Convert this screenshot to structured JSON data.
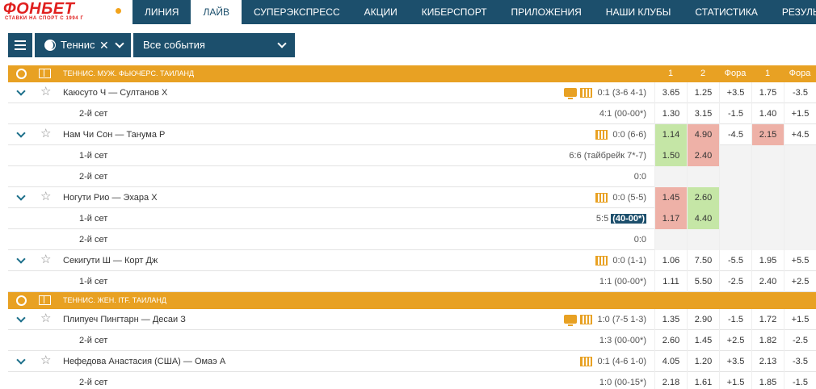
{
  "header": {
    "logo_title": "ФОНБЕТ",
    "logo_subtitle": "СТАВКИ НА СПОРТ С 1994 Г",
    "nav": [
      {
        "label": "ЛИНИЯ",
        "active": false
      },
      {
        "label": "ЛАЙВ",
        "active": true
      },
      {
        "label": "СУПЕРЭКСПРЕСС",
        "active": false
      },
      {
        "label": "АКЦИИ",
        "active": false
      },
      {
        "label": "КИБЕРСПОРТ",
        "active": false
      },
      {
        "label": "ПРИЛОЖЕНИЯ",
        "active": false
      },
      {
        "label": "НАШИ КЛУБЫ",
        "active": false
      },
      {
        "label": "СТАТИСТИКА",
        "active": false
      },
      {
        "label": "РЕЗУЛЬТАТЫ",
        "active": false
      }
    ]
  },
  "filters": {
    "sport": "Теннис",
    "clear_icon": "✕",
    "events": "Все события"
  },
  "columns": [
    "1",
    "2",
    "Фора",
    "1",
    "Фора"
  ],
  "colors": {
    "brand": "#1c4f6c",
    "league": "#e8a123",
    "up": "#c5e6a6",
    "down": "#eeb1a7",
    "logo": "#e0201f"
  },
  "leagues": [
    {
      "name": "Теннис. Муж. Фьючерс. Таиланд",
      "rows": [
        {
          "type": "match",
          "name": "Каюсуто Ч — Султанов Х",
          "score": "0:1 (3-6 4-1)",
          "tv": true,
          "stats": true,
          "odds": [
            {
              "v": "3.65"
            },
            {
              "v": "1.25"
            },
            {
              "v": "+3.5"
            },
            {
              "v": "1.75"
            },
            {
              "v": "-3.5"
            }
          ]
        },
        {
          "type": "set",
          "name": "2-й сет",
          "score": "4:1 (00-00*)",
          "odds": [
            {
              "v": "1.30"
            },
            {
              "v": "3.15"
            },
            {
              "v": "-1.5"
            },
            {
              "v": "1.40"
            },
            {
              "v": "+1.5"
            }
          ]
        },
        {
          "type": "match",
          "name": "Нам Чи Сон — Танума Р",
          "score": "0:0 (6-6)",
          "tv": false,
          "stats": true,
          "odds": [
            {
              "v": "1.14",
              "c": "green"
            },
            {
              "v": "4.90",
              "c": "red"
            },
            {
              "v": "-4.5"
            },
            {
              "v": "2.15",
              "c": "red"
            },
            {
              "v": "+4.5"
            }
          ]
        },
        {
          "type": "set",
          "name": "1-й сет",
          "score": "6:6 (тайбрейк 7*-7)",
          "odds": [
            {
              "v": "1.50",
              "c": "green"
            },
            {
              "v": "2.40",
              "c": "red"
            },
            {
              "v": "",
              "c": "empty"
            },
            {
              "v": "",
              "c": "empty"
            },
            {
              "v": "",
              "c": "empty"
            }
          ]
        },
        {
          "type": "set",
          "name": "2-й сет",
          "score": "0:0",
          "odds": [
            {
              "v": "",
              "c": "empty"
            },
            {
              "v": "",
              "c": "empty"
            },
            {
              "v": "",
              "c": "empty"
            },
            {
              "v": "",
              "c": "empty"
            },
            {
              "v": "",
              "c": "empty"
            }
          ]
        },
        {
          "type": "match",
          "name": "Ногути Рио — Эхара Х",
          "score": "0:0 (5-5)",
          "tv": false,
          "stats": true,
          "odds": [
            {
              "v": "1.45",
              "c": "red"
            },
            {
              "v": "2.60",
              "c": "green"
            },
            {
              "v": "",
              "c": "empty"
            },
            {
              "v": "",
              "c": "empty"
            },
            {
              "v": "",
              "c": "empty"
            }
          ]
        },
        {
          "type": "set",
          "name": "1-й сет",
          "score": "5:5",
          "score_hl": "(40-00*)",
          "odds": [
            {
              "v": "1.17",
              "c": "red"
            },
            {
              "v": "4.40",
              "c": "green"
            },
            {
              "v": "",
              "c": "empty"
            },
            {
              "v": "",
              "c": "empty"
            },
            {
              "v": "",
              "c": "empty"
            }
          ]
        },
        {
          "type": "set",
          "name": "2-й сет",
          "score": "0:0",
          "odds": [
            {
              "v": "",
              "c": "empty"
            },
            {
              "v": "",
              "c": "empty"
            },
            {
              "v": "",
              "c": "empty"
            },
            {
              "v": "",
              "c": "empty"
            },
            {
              "v": "",
              "c": "empty"
            }
          ]
        },
        {
          "type": "match",
          "name": "Секигути Ш — Корт Дж",
          "score": "0:0 (1-1)",
          "tv": false,
          "stats": true,
          "odds": [
            {
              "v": "1.06"
            },
            {
              "v": "7.50"
            },
            {
              "v": "-5.5"
            },
            {
              "v": "1.95"
            },
            {
              "v": "+5.5"
            }
          ]
        },
        {
          "type": "set",
          "name": "1-й сет",
          "score": "1:1 (00-00*)",
          "odds": [
            {
              "v": "1.11"
            },
            {
              "v": "5.50"
            },
            {
              "v": "-2.5"
            },
            {
              "v": "2.40"
            },
            {
              "v": "+2.5"
            }
          ]
        }
      ]
    },
    {
      "name": "Теннис. Жен. ITF. Таиланд",
      "rows": [
        {
          "type": "match",
          "name": "Плипуеч Пингтарн — Десаи З",
          "score": "1:0 (7-5 1-3)",
          "tv": true,
          "stats": true,
          "odds": [
            {
              "v": "1.35"
            },
            {
              "v": "2.90"
            },
            {
              "v": "-1.5"
            },
            {
              "v": "1.72"
            },
            {
              "v": "+1.5"
            }
          ]
        },
        {
          "type": "set",
          "name": "2-й сет",
          "score": "1:3 (00-00*)",
          "odds": [
            {
              "v": "2.60"
            },
            {
              "v": "1.45"
            },
            {
              "v": "+2.5"
            },
            {
              "v": "1.82"
            },
            {
              "v": "-2.5"
            }
          ]
        },
        {
          "type": "match",
          "name": "Нефедова Анастасия (США) — Омаэ А",
          "score": "0:1 (4-6 1-0)",
          "tv": false,
          "stats": true,
          "odds": [
            {
              "v": "4.05"
            },
            {
              "v": "1.20"
            },
            {
              "v": "+3.5"
            },
            {
              "v": "2.13"
            },
            {
              "v": "-3.5"
            }
          ]
        },
        {
          "type": "set",
          "name": "2-й сет",
          "score": "1:0 (00-15*)",
          "odds": [
            {
              "v": "2.18"
            },
            {
              "v": "1.61"
            },
            {
              "v": "+1.5"
            },
            {
              "v": "1.85"
            },
            {
              "v": "-1.5"
            }
          ]
        }
      ]
    }
  ]
}
